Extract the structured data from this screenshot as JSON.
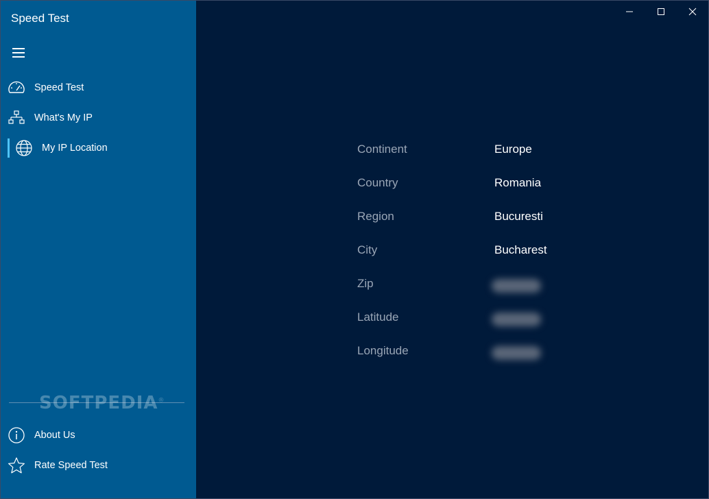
{
  "app": {
    "title": "Speed Test"
  },
  "colors": {
    "sidebar": "#005a91",
    "content": "#001a3a",
    "accent": "#4fc3f7",
    "label": "#9aa6b6",
    "value": "#ffffff"
  },
  "nav": {
    "menu_icon": "hamburger-icon",
    "items": [
      {
        "label": "Speed Test",
        "icon": "speedometer-icon"
      },
      {
        "label": "What's My IP",
        "icon": "network-icon"
      },
      {
        "label": "My IP Location",
        "icon": "globe-icon",
        "selected": true
      }
    ],
    "footer_items": [
      {
        "label": "About Us",
        "icon": "info-icon"
      },
      {
        "label": "Rate Speed Test",
        "icon": "star-icon"
      }
    ]
  },
  "watermark": {
    "text": "SOFTPEDIA",
    "mark": "®"
  },
  "window_controls": [
    "minimize-icon",
    "maximize-icon",
    "close-icon"
  ],
  "location": {
    "rows": [
      {
        "label": "Continent",
        "value": "Europe"
      },
      {
        "label": "Country",
        "value": "Romania"
      },
      {
        "label": "Region",
        "value": "Bucuresti"
      },
      {
        "label": "City",
        "value": "Bucharest"
      },
      {
        "label": "Zip",
        "value": null
      },
      {
        "label": "Latitude",
        "value": null
      },
      {
        "label": "Longitude",
        "value": null
      }
    ]
  }
}
